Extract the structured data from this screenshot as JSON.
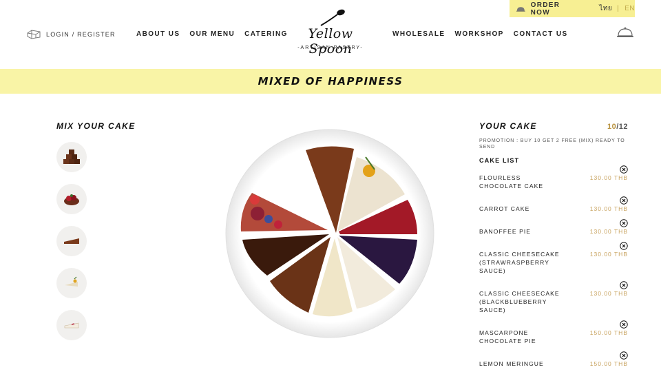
{
  "header": {
    "order_now": "ORDER NOW",
    "lang_th": "ไทย",
    "lang_sep": "|",
    "lang_en": "EN",
    "login": "LOGIN / REGISTER",
    "nav_left": [
      "ABOUT US",
      "OUR MENU",
      "CATERING"
    ],
    "nav_right": [
      "WHOLESALE",
      "WORKSHOP",
      "CONTACT US"
    ],
    "logo_script": "Yellow Spoon",
    "logo_sub": "-ARTISAN PASTRY-"
  },
  "banner": {
    "title": "MIXED OF HAPPINESS"
  },
  "mixer": {
    "title": "MIX YOUR CAKE",
    "slices": [
      "chocolate-cubes-icon",
      "berry-tart-icon",
      "cake-slice-icon",
      "garnished-slice-icon",
      "cheesecake-slice-icon"
    ]
  },
  "panel": {
    "title": "YOUR CAKE",
    "count_current": "10",
    "count_total": "/12",
    "promo": "PROMOTION : BUY 10 GET 2 FREE (MIX) READY TO SEND",
    "list_title": "CAKE LIST",
    "items": [
      {
        "name": "FLOURLESS CHOCOLATE CAKE",
        "price": "130.00 THB"
      },
      {
        "name": "CARROT CAKE",
        "price": "130.00 THB"
      },
      {
        "name": "BANOFFEE PIE",
        "price": "130.00 THB"
      },
      {
        "name": "CLASSIC CHEESECAKE (STRAWRASPBERRY SAUCE)",
        "price": "130.00 THB"
      },
      {
        "name": "CLASSIC CHEESECAKE (BLACKBLUEBERRY SAUCE)",
        "price": "130.00 THB"
      },
      {
        "name": "MASCARPONE CHOCOLATE PIE",
        "price": "150.00 THB"
      },
      {
        "name": "LEMON MERINGUE",
        "price": "150.00 THB"
      }
    ]
  },
  "colors": {
    "accent_yellow": "#f9f4a6",
    "order_bar": "#f7ef93",
    "price_gold": "#c7a15c"
  }
}
